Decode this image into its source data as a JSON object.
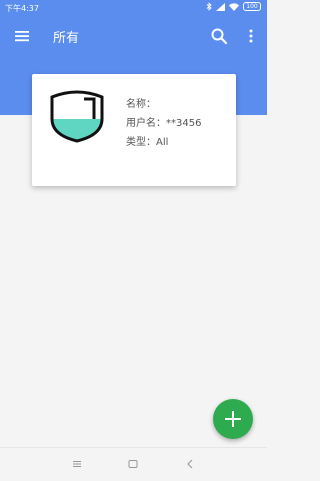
{
  "status": {
    "time": "下午4:37",
    "battery": "100"
  },
  "app_bar": {
    "title": "所有"
  },
  "entry": {
    "name_label": "名称：",
    "name_value": "",
    "username_label": "用户名：",
    "username_value": "**3456",
    "type_label": "类型：",
    "type_value": "All"
  },
  "colors": {
    "primary": "#5b8def",
    "fab": "#2eaa4f",
    "logo_accent": "#5fd6c2"
  },
  "icons": [
    "menu-icon",
    "search-icon",
    "more-vert-icon",
    "shield-logo-icon",
    "plus-icon",
    "nav-menu-icon",
    "nav-home-icon",
    "nav-back-icon"
  ]
}
